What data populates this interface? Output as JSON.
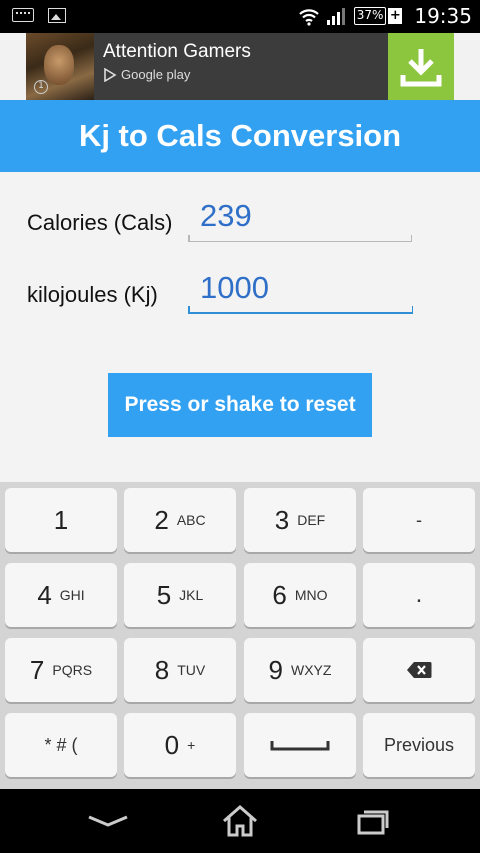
{
  "status_bar": {
    "battery_percent": "37%",
    "battery_charging": "+",
    "time": "19:35"
  },
  "ad": {
    "title": "Attention Gamers",
    "store": "Google play",
    "badge": "1",
    "download_color": "#8cc63f"
  },
  "app": {
    "title": "Kj to Cals Conversion",
    "accent": "#33a1f2"
  },
  "form": {
    "calories_label": "Calories (Cals)",
    "calories_value": "239",
    "kilojoules_label": "kilojoules (Kj)",
    "kilojoules_value": "1000",
    "reset_label": "Press or shake to reset"
  },
  "keypad": {
    "keys": [
      {
        "main": "1",
        "sub": ""
      },
      {
        "main": "2",
        "sub": "ABC"
      },
      {
        "main": "3",
        "sub": "DEF"
      },
      {
        "main": "-",
        "sub": ""
      },
      {
        "main": "4",
        "sub": "GHI"
      },
      {
        "main": "5",
        "sub": "JKL"
      },
      {
        "main": "6",
        "sub": "MNO"
      },
      {
        "main": ".",
        "sub": ""
      },
      {
        "main": "7",
        "sub": "PQRS"
      },
      {
        "main": "8",
        "sub": "TUV"
      },
      {
        "main": "9",
        "sub": "WXYZ"
      },
      {
        "main": "",
        "sub": "",
        "icon": "backspace-icon"
      },
      {
        "main": "",
        "sub": "",
        "label": "* # ("
      },
      {
        "main": "0",
        "sub": "+"
      },
      {
        "main": "",
        "sub": "",
        "icon": "space-icon"
      },
      {
        "main": "",
        "sub": "",
        "label": "Previous"
      }
    ]
  },
  "nav_bar": {
    "back_icon": "back-icon",
    "home_icon": "home-icon",
    "recents_icon": "recents-icon"
  }
}
